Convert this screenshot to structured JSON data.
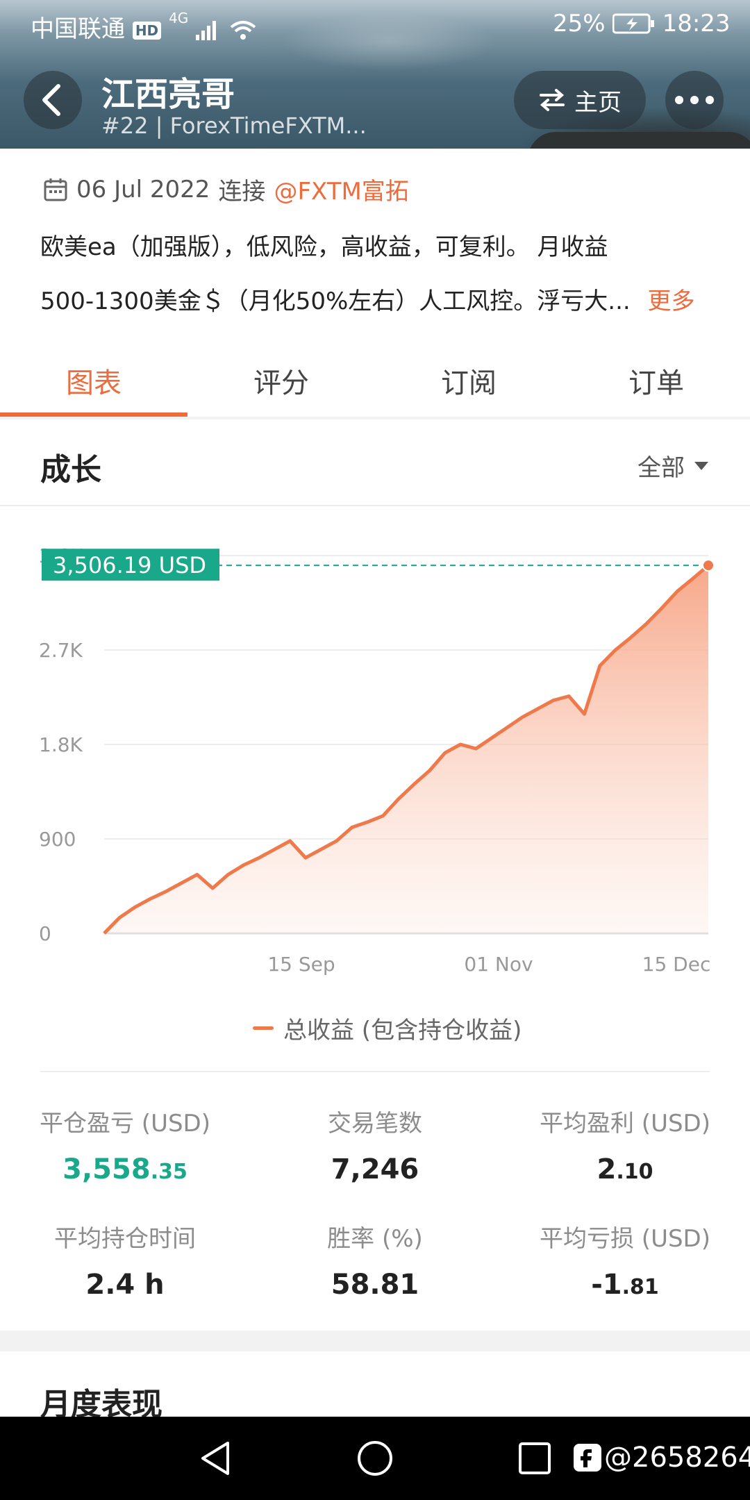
{
  "status_bar": {
    "carrier": "中国联通",
    "network_badge": "HD",
    "signal": "4G",
    "battery": "25%",
    "time": "18:23"
  },
  "header": {
    "title": "江西亮哥",
    "subtitle": "#22 | ForexTimeFXTM...",
    "home_label": "主页"
  },
  "info": {
    "date": "06 Jul 2022",
    "connect_text": "连接",
    "broker": "@FXTM富拓",
    "desc_line1": "欧美ea（加强版），低风险，高收益，可复利。 月收益",
    "desc_line2": "500-1300美金＄（月化50%左右）人工风控。浮亏大...",
    "more_label": "更多"
  },
  "tabs": [
    {
      "label": "图表",
      "active": true
    },
    {
      "label": "评分",
      "active": false
    },
    {
      "label": "订阅",
      "active": false
    },
    {
      "label": "订单",
      "active": false
    }
  ],
  "growth": {
    "title": "成长",
    "filter_label": "全部"
  },
  "chart_data": {
    "type": "area",
    "title": "",
    "y_ticks": [
      "0",
      "900",
      "1.8K",
      "2.7K",
      "3.6K"
    ],
    "x_ticks": [
      "15 Sep",
      "01 Nov",
      "15 Dec"
    ],
    "ylim": [
      0,
      3600
    ],
    "current_label": "3,506.19 USD",
    "current_value": 3506.19,
    "legend": "总收益 (包含持仓收益)",
    "series": [
      {
        "name": "总收益 (包含持仓收益)",
        "color": "#ee7a4c",
        "values": [
          0,
          150,
          250,
          330,
          400,
          480,
          560,
          430,
          560,
          650,
          720,
          800,
          880,
          720,
          800,
          880,
          1010,
          1060,
          1120,
          1280,
          1420,
          1550,
          1720,
          1800,
          1760,
          1860,
          1960,
          2060,
          2140,
          2220,
          2260,
          2090,
          2550,
          2700,
          2820,
          2950,
          3100,
          3260,
          3380,
          3506.19
        ]
      }
    ]
  },
  "stats": [
    {
      "label": "平仓盈亏 (USD)",
      "main": "3,558",
      "frac": ".35",
      "color": "green"
    },
    {
      "label": "交易笔数",
      "main": "7,246",
      "frac": "",
      "color": "dark"
    },
    {
      "label": "平均盈利 (USD)",
      "main": "2",
      "frac": ".10",
      "color": "dark"
    },
    {
      "label": "平均持仓时间",
      "main": "2.4 h",
      "frac": "",
      "color": "dark"
    },
    {
      "label": "胜率 (%)",
      "main": "58.81",
      "frac": "",
      "color": "dark"
    },
    {
      "label": "平均亏损 (USD)",
      "main": "-1",
      "frac": ".81",
      "color": "dark"
    }
  ],
  "monthly": {
    "title": "月度表现"
  },
  "nav": {
    "watermark": "@2658264"
  }
}
